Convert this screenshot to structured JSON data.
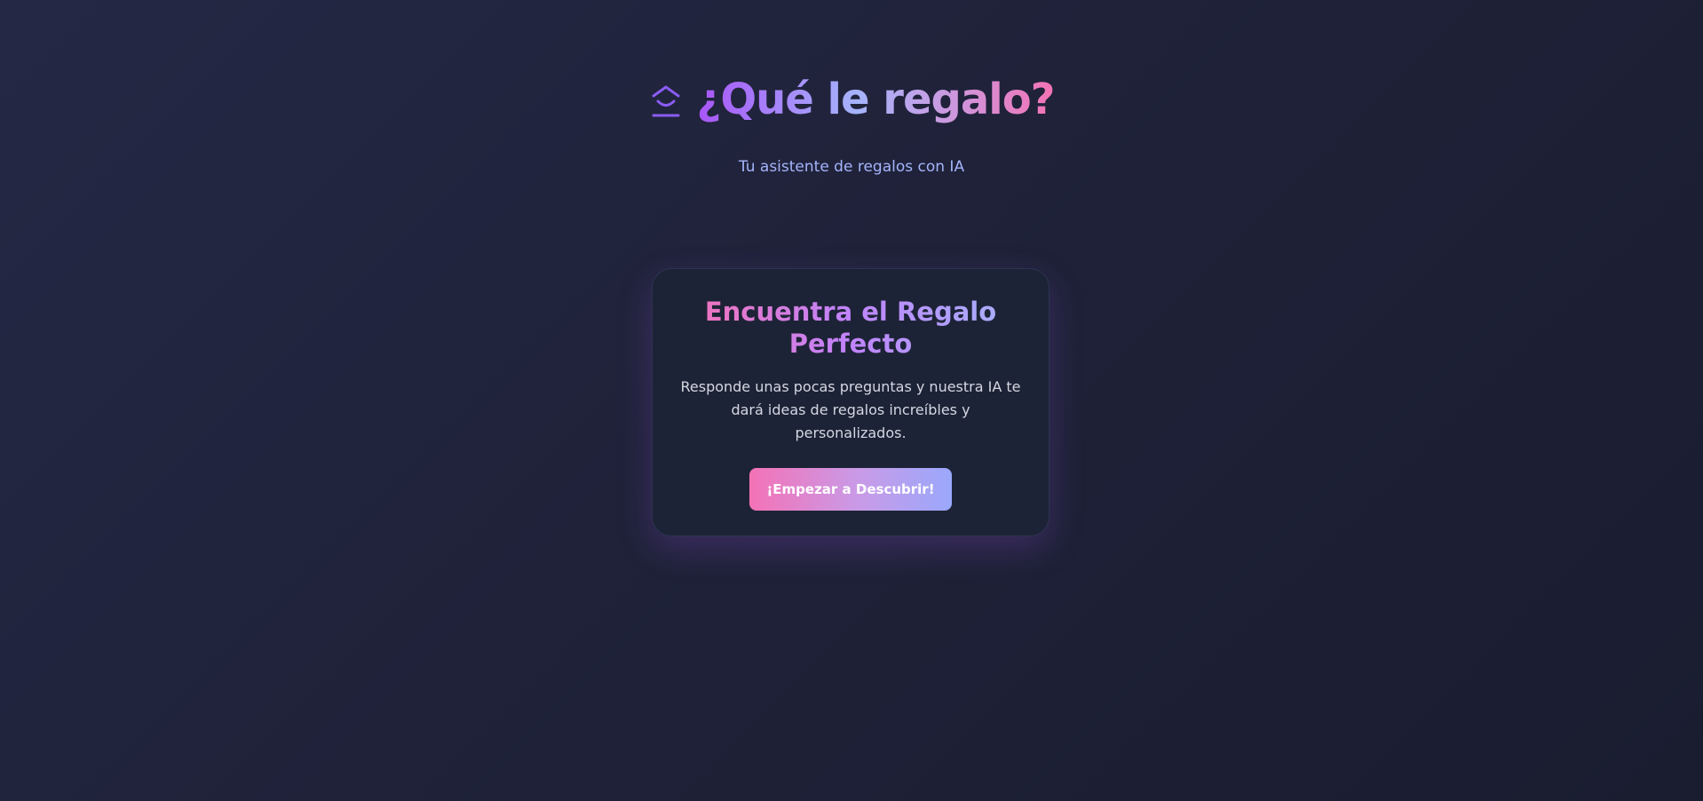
{
  "header": {
    "icon": "gift-icon",
    "title": "¿Qué le regalo?",
    "subtitle": "Tu asistente de regalos con IA"
  },
  "card": {
    "title": "Encuentra el Regalo Perfecto",
    "description": "Responde unas pocas preguntas y nuestra IA te dará ideas de regalos increíbles y personalizados.",
    "button_label": "¡Empezar a Descubrir!"
  },
  "colors": {
    "background": "#1f2239",
    "card_background": "#1d2336",
    "accent_purple": "#a855f7",
    "accent_pink": "#f472b6",
    "accent_indigo": "#a5b4fc",
    "subtitle": "#a5b4fc"
  }
}
